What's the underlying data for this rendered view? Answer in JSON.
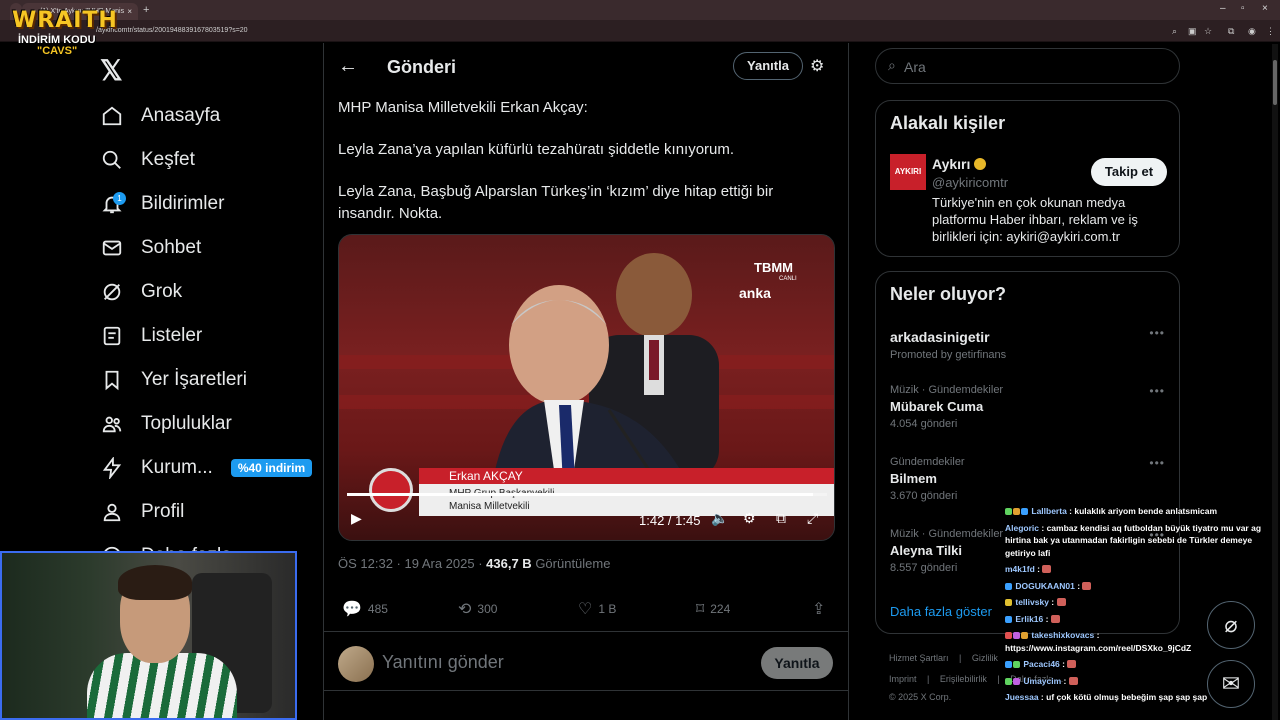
{
  "browser": {
    "tab1_title": "",
    "tab2_title": "(1) X'te Aykırı: \"MHP Manis",
    "url": "/aykiricomtr/status/2001948839167803519?s=20"
  },
  "overlay_logo": {
    "title": "WRAITH",
    "subtitle": "İNDİRİM KODU",
    "code": "\"CAVS\""
  },
  "nav": {
    "items": [
      {
        "label": "Anasayfa"
      },
      {
        "label": "Keşfet"
      },
      {
        "label": "Bildirimler",
        "badge": "1"
      },
      {
        "label": "Sohbet"
      },
      {
        "label": "Grok"
      },
      {
        "label": "Listeler"
      },
      {
        "label": "Yer İşaretleri"
      },
      {
        "label": "Topluluklar"
      },
      {
        "label": "Kurum...",
        "promo": "%40 indirim"
      },
      {
        "label": "Profil"
      },
      {
        "label": "Daha fazla"
      }
    ]
  },
  "post": {
    "header_title": "Gönderi",
    "reply_pill": "Yanıtla",
    "text_lines": [
      "MHP Manisa Milletvekili Erkan Akçay:",
      "Leyla Zana’ya yapılan küfürlü tezahüratı şiddetle kınıyorum.",
      "Leyla Zana, Başbuğ Alparslan Türkeş’in ‘kızım’ diye hitap ettiği bir insandır. Nokta."
    ],
    "video": {
      "channel": "TBMM",
      "channel_sub": "CANLI",
      "agency": "anka",
      "lower_third_name": "Erkan AKÇAY",
      "lower_third_role": "MHP Grup Başkanvekili",
      "lower_third_region": "Manisa Milletvekili",
      "time": "1:42 / 1:45",
      "progress": 0.971
    },
    "time_date": "ÖS 12:32 · 19 Ara 2025 · ",
    "views": "436,7 B",
    "views_label": " Görüntüleme",
    "replies": "485",
    "reposts": "300",
    "likes": "1 B",
    "bookmarks": "224",
    "composer_placeholder": "Yanıtını gönder",
    "composer_button": "Yanıtla"
  },
  "right": {
    "search_placeholder": "Ara",
    "related_title": "Alakalı kişiler",
    "related": {
      "avatar_text": "AYKIRI",
      "name": "Aykırı",
      "handle": "@aykiricomtr",
      "bio": "Türkiye'nin en çok okunan medya platformu Haber ihbarı, reklam ve iş birlikleri için: aykiri@aykiri.com.tr",
      "follow": "Takip et"
    },
    "trends_title": "Neler oluyor?",
    "trends": [
      {
        "cat": "",
        "name": "arkadasinigetir",
        "cnt": "Promoted by getirfinans"
      },
      {
        "cat": "Müzik · Gündemdekiler",
        "name": "Mübarek Cuma",
        "cnt": "4.054 gönderi"
      },
      {
        "cat": "Gündemdekiler",
        "name": "Bilmem",
        "cnt": "3.670 gönderi"
      },
      {
        "cat": "Müzik · Gündemdekiler",
        "name": "Aleyna Tilki",
        "cnt": "8.557 gönderi"
      }
    ],
    "show_more": "Daha fazla göster",
    "footer": {
      "l1a": "Hizmet Şartları",
      "l1b": "Gizlilik",
      "l2a": "Imprint",
      "l2b": "Erişilebilirlik",
      "l2c": "Daha fazla ...",
      "copyright": "© 2025 X Corp."
    }
  },
  "chat": [
    {
      "user": "Lallberta",
      "text": "kulaklık ariyom bende anlatsmicam"
    },
    {
      "user": "Alegoric",
      "text": "cambaz kendisi aq futboldan büyük tiyatro mu var ag hirtina bak ya utanmadan fakirligin sebebi de Türkler demeye getiriyo lafi"
    },
    {
      "user": "m4k1fd",
      "text": ""
    },
    {
      "user": "DOGUKAAN01",
      "text": ""
    },
    {
      "user": "tellivsky",
      "text": ""
    },
    {
      "user": "Erlik16",
      "text": ""
    },
    {
      "user": "takeshixkovacs",
      "text": "https://www.instagram.com/reel/DSXko_9jCdZ"
    },
    {
      "user": "Pacaci46",
      "text": ""
    },
    {
      "user": "Umaycim",
      "text": ""
    },
    {
      "user": "Juessaa",
      "text": "uf çok kötü olmuş bebeğim şap şap şap"
    }
  ]
}
